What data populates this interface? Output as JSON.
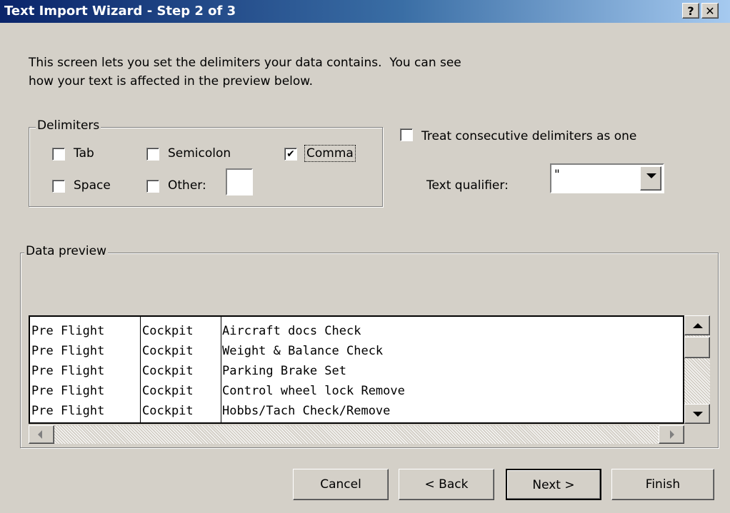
{
  "window": {
    "title": "Text Import Wizard - Step 2 of 3",
    "help_glyph": "?",
    "close_glyph": "✕"
  },
  "intro": {
    "line1": "This screen lets you set the delimiters your data contains.  You can see",
    "line2": "how your text is affected in the preview below."
  },
  "delimiters": {
    "group_label": "Delimiters",
    "tab": {
      "label": "Tab",
      "checked": false
    },
    "semicolon": {
      "label": "Semicolon",
      "checked": false
    },
    "comma": {
      "label": "Comma",
      "checked": true
    },
    "space": {
      "label": "Space",
      "checked": false
    },
    "other": {
      "label": "Other:",
      "checked": false,
      "value": ""
    }
  },
  "options": {
    "consecutive_label": "Treat consecutive delimiters as one",
    "consecutive_checked": false,
    "qualifier_label": "Text qualifier:",
    "qualifier_value": "\""
  },
  "preview": {
    "group_label": "Data preview",
    "rows": [
      [
        "Pre Flight",
        "Cockpit",
        "Aircraft docs Check"
      ],
      [
        "Pre Flight",
        "Cockpit",
        "Weight & Balance Check"
      ],
      [
        "Pre Flight",
        "Cockpit",
        "Parking Brake Set"
      ],
      [
        "Pre Flight",
        "Cockpit",
        "Control wheel lock Remove"
      ],
      [
        "Pre Flight",
        "Cockpit",
        "Hobbs/Tach Check/Remove"
      ]
    ]
  },
  "buttons": {
    "cancel": "Cancel",
    "back": "< Back",
    "next": "Next >",
    "finish": "Finish"
  }
}
